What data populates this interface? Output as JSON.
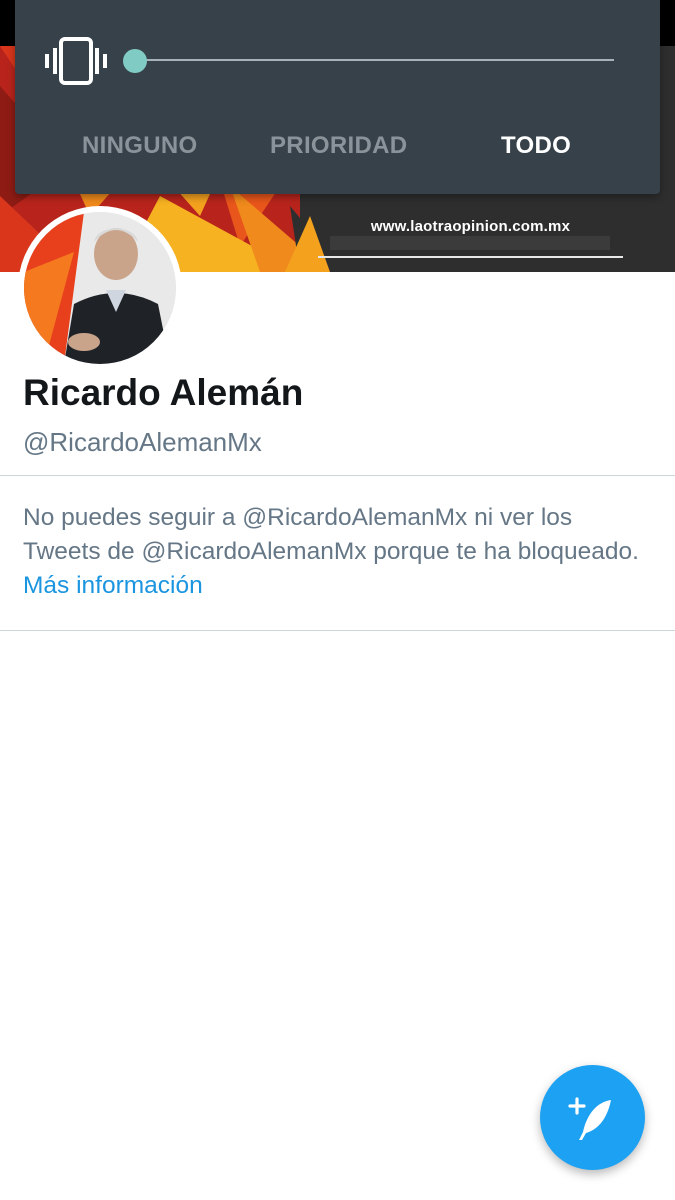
{
  "banner": {
    "url_text": "www.laotraopinion.com.mx"
  },
  "profile": {
    "name": "Ricardo Alemán",
    "handle": "@RicardoAlemanMx"
  },
  "blocked_notice": {
    "text": "No puedes seguir a @RicardoAlemanMx ni ver los Tweets de @RicardoAlemanMx porque te ha bloqueado.",
    "link_label": "Más información"
  },
  "volume_panel": {
    "icon": "vibrate-icon",
    "slider_level": 0,
    "modes": [
      "NINGUNO",
      "PRIORIDAD",
      "TODO"
    ],
    "selected_mode": "TODO"
  },
  "fab": {
    "icon": "compose-tweet-icon"
  },
  "colors": {
    "accent": "#1da1f2",
    "link": "#1b95e0",
    "panel_bg": "#37414a",
    "slider_thumb": "#80cbc4"
  }
}
